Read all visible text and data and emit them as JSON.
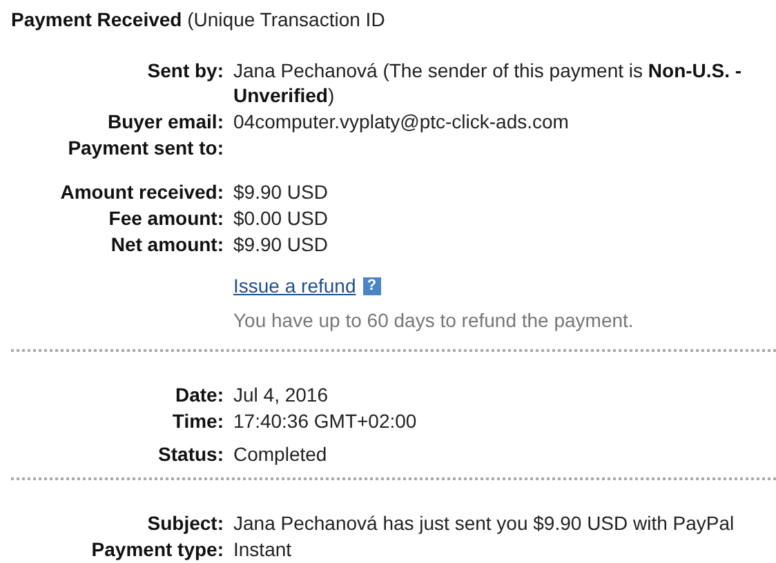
{
  "title": "**Payment Received** (Unique Transaction ID",
  "sections": [
    {
      "groups": [
        {
          "rows": [
            {
              "label": "Sent by:",
              "value": "Jana Pechanová (The sender of this payment is **Non-U.S. - Unverified**)"
            },
            {
              "label": "Buyer email:",
              "value": "04computer.vyplaty@ptc-click-ads.com"
            },
            {
              "label": "Payment sent to:"
            }
          ]
        },
        {
          "rows": [
            {
              "label": "Amount received:",
              "value": "$9.90 USD"
            },
            {
              "label": "Fee amount:",
              "value": "$0.00 USD"
            },
            {
              "label": "Net amount:",
              "value": "$9.90 USD"
            }
          ]
        }
      ],
      "refund": {
        "link": "Issue a refund",
        "help": "?",
        "note": "You have up to 60 days to refund the payment."
      }
    },
    {
      "groups": [
        {
          "rows": [
            {
              "label": "Date:",
              "value": "Jul 4, 2016"
            },
            {
              "label": "Time:",
              "value": "17:40:36 GMT+02:00"
            }
          ]
        },
        {
          "rows": [
            {
              "label": "Status:",
              "value": "Completed"
            }
          ]
        }
      ]
    },
    {
      "groups": [
        {
          "rows": [
            {
              "label": "Subject:",
              "value": "Jana Pechanová has just sent you $9.90 USD with PayPal"
            },
            {
              "label": "Payment type:",
              "value": "Instant"
            }
          ]
        }
      ]
    }
  ]
}
